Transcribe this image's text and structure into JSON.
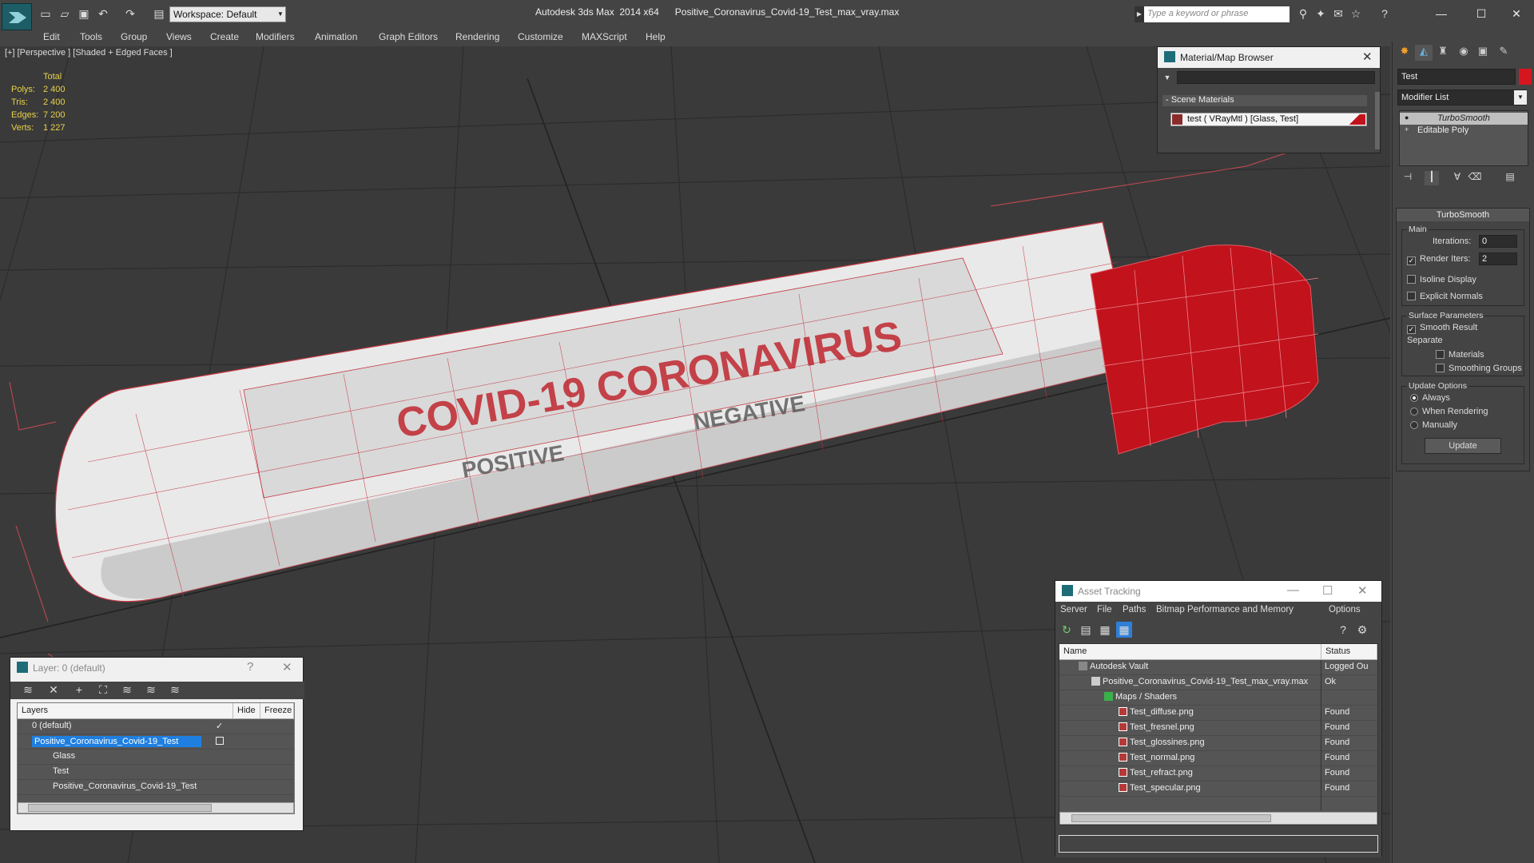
{
  "app": {
    "workspace": "Workspace: Default",
    "title": "Autodesk 3ds Max  2014 x64      Positive_Coronavirus_Covid-19_Test_max_vray.max",
    "search_placeholder": "Type a keyword or phrase"
  },
  "menu": [
    "Edit",
    "Tools",
    "Group",
    "Views",
    "Create",
    "Modifiers",
    "Animation",
    "Graph Editors",
    "Rendering",
    "Customize",
    "MAXScript",
    "Help"
  ],
  "viewport": {
    "label": "[+] [Perspective ] [Shaded + Edged Faces ]",
    "stats": {
      "header": "Total",
      "rows": [
        {
          "label": "Polys:",
          "value": "2 400"
        },
        {
          "label": "Tris:",
          "value": "2 400"
        },
        {
          "label": "Edges:",
          "value": "7 200"
        },
        {
          "label": "Verts:",
          "value": "1 227"
        }
      ]
    },
    "label_text_main": "COVID-19  CORONAVIRUS",
    "label_text_pos": "POSITIVE",
    "label_text_neg": "NEGATIVE",
    "cap_color": "#c2121c",
    "tube_color": "#e8e8e8"
  },
  "material_browser": {
    "title": "Material/Map Browser",
    "group": "- Scene Materials",
    "item": "test  ( VRayMtl )  [Glass, Test]"
  },
  "command_panel": {
    "object_name": "Test",
    "modifier_list": "Modifier List",
    "stack": [
      "TurboSmooth",
      "Editable Poly"
    ],
    "rollout_title": "TurboSmooth",
    "main_group": "Main",
    "iterations_label": "Iterations:",
    "iterations_value": "0",
    "render_iters_label": "Render Iters:",
    "render_iters_value": "2",
    "isoline": "Isoline Display",
    "explicit": "Explicit Normals",
    "surface_group": "Surface Parameters",
    "smooth_result": "Smooth Result",
    "separate": "Separate",
    "materials": "Materials",
    "smoothing_groups": "Smoothing Groups",
    "update_group": "Update Options",
    "always": "Always",
    "when_rendering": "When Rendering",
    "manually": "Manually",
    "update_btn": "Update"
  },
  "layer_window": {
    "title": "Layer: 0 (default)",
    "help": "?",
    "col_layers": "Layers",
    "col_hide": "Hide",
    "col_freeze": "Freeze",
    "rows": [
      {
        "name": "0 (default)"
      },
      {
        "name": "Positive_Coronavirus_Covid-19_Test"
      },
      {
        "name": "Glass"
      },
      {
        "name": "Test"
      },
      {
        "name": "Positive_Coronavirus_Covid-19_Test"
      }
    ]
  },
  "asset_tracking": {
    "title": "Asset Tracking",
    "menu": [
      "Server",
      "File",
      "Paths",
      "Bitmap Performance and Memory",
      "Options"
    ],
    "col_name": "Name",
    "col_status": "Status",
    "rows": [
      {
        "name": "Autodesk Vault",
        "status": "Logged Ou"
      },
      {
        "name": "Positive_Coronavirus_Covid-19_Test_max_vray.max",
        "status": "Ok"
      },
      {
        "name": "Maps / Shaders",
        "status": ""
      },
      {
        "name": "Test_diffuse.png",
        "status": "Found"
      },
      {
        "name": "Test_fresnel.png",
        "status": "Found"
      },
      {
        "name": "Test_glossines.png",
        "status": "Found"
      },
      {
        "name": "Test_normal.png",
        "status": "Found"
      },
      {
        "name": "Test_refract.png",
        "status": "Found"
      },
      {
        "name": "Test_specular.png",
        "status": "Found"
      }
    ]
  }
}
